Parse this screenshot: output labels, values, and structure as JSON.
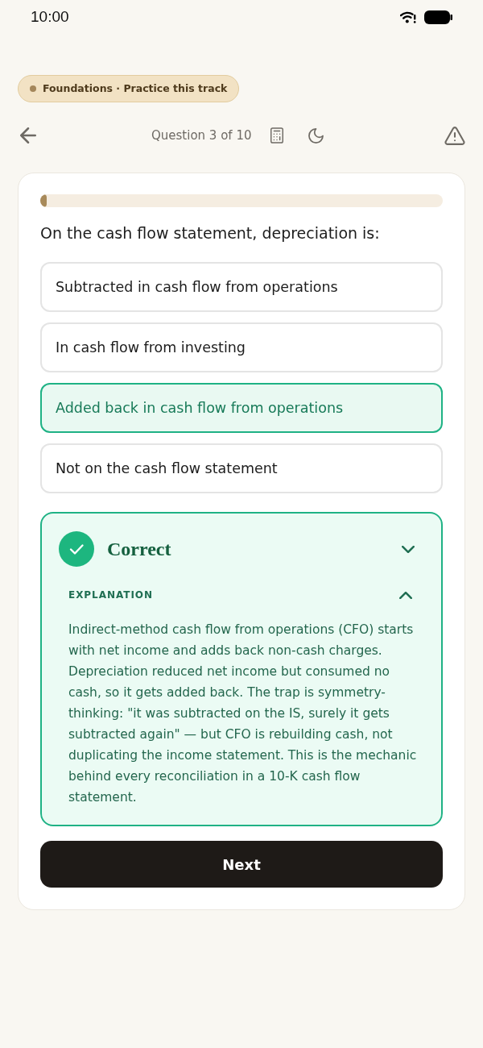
{
  "status_bar": {
    "time": "10:00"
  },
  "track_badge": {
    "label": "Foundations · Practice this track"
  },
  "header": {
    "counter": "Question 3 of 10"
  },
  "quiz": {
    "progress": {
      "level": 0.016
    },
    "question": "On the cash flow statement, depreciation is:",
    "options": [
      {
        "text": "Subtracted in cash flow from operations",
        "selected": false
      },
      {
        "text": "In cash flow from investing",
        "selected": false
      },
      {
        "text": "Added back in cash flow from operations",
        "selected": true
      },
      {
        "text": "Not on the cash flow statement",
        "selected": false
      }
    ],
    "feedback": {
      "correct": true,
      "title": "Correct",
      "explanation": {
        "label": "EXPLANATION",
        "expanded": true,
        "text": "Indirect-method cash flow from operations (CFO) starts with net income and adds back non-cash charges. Depreciation reduced net income but consumed no cash, so it gets added back. The trap is symmetry-thinking: \"it was subtracted on the IS, surely it gets subtracted again\" — but CFO is rebuilding cash, not duplicating the income statement. This is the mechanic behind every reconciliation in a 10-K cash flow statement."
      }
    },
    "next_button": {
      "label": "Next"
    }
  }
}
